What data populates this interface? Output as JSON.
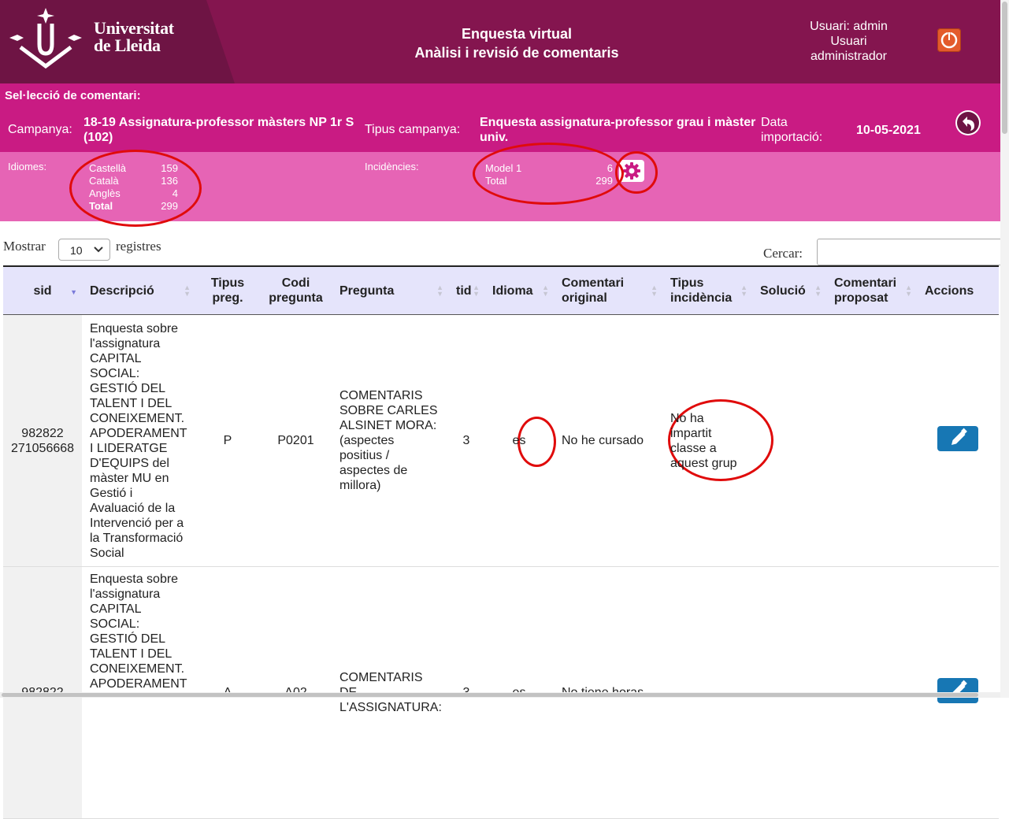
{
  "header": {
    "logo_line1": "Universitat",
    "logo_line2": "de Lleida",
    "title_line1": "Enquesta virtual",
    "title_line2": "Anàlisi i revisió de comentaris",
    "user_line1": "Usuari: admin",
    "user_line2": "Usuari",
    "user_line3": "administrador",
    "logout_icon": "power-icon"
  },
  "selection": {
    "title": "Sel·lecció de comentari:",
    "campaign_label": "Campanya:",
    "campaign_value": "18-19 Assignatura-professor màsters NP 1r S (102)",
    "type_label": "Tipus campanya:",
    "type_value": "Enquesta assignatura-professor grau i màster univ.",
    "date_label": "Data importació:",
    "date_value": "10-05-2021",
    "back_icon": "back-arrow-icon"
  },
  "stats": {
    "languages_label": "Idiomes:",
    "languages": [
      {
        "name": "Castellà",
        "count": "159"
      },
      {
        "name": "Català",
        "count": "136"
      },
      {
        "name": "Anglès",
        "count": "4"
      },
      {
        "name": "Total",
        "count": "299"
      }
    ],
    "incidents_label": "Incidències:",
    "incidents": [
      {
        "name": "Model 1",
        "count": "6"
      },
      {
        "name": "Total",
        "count": "299"
      }
    ],
    "gear_icon": "gear-icon"
  },
  "controls": {
    "show_label": "Mostrar",
    "length_value": "10",
    "records_label": "registres",
    "search_label": "Cercar:",
    "search_value": ""
  },
  "table": {
    "headers": {
      "sid": "sid",
      "descripcio": "Descripció",
      "tipus_preg": "Tipus preg.",
      "codi": "Codi pregunta",
      "pregunta": "Pregunta",
      "tid": "tid",
      "idioma": "Idioma",
      "comentari": "Comentari original",
      "tipus_inc": "Tipus incidència",
      "solucio": "Solució",
      "proposat": "Comentari proposat",
      "accions": "Accions"
    },
    "rows": [
      {
        "sid_a": "982822",
        "sid_b": "271056668",
        "descripcio": "Enquesta sobre l'assignatura CAPITAL SOCIAL: GESTIÓ DEL TALENT I DEL CONEIXEMENT. APODERAMENT I LIDERATGE D'EQUIPS del màster MU en Gestió i Avaluació de la Intervenció per a la Transformació Social",
        "tipus": "P",
        "codi": "P0201",
        "pregunta": "COMENTARIS SOBRE CARLES ALSINET MORA: (aspectes positius / aspectes de millora)",
        "tid": "3",
        "idioma": "es",
        "comentari": "No he cursado",
        "incidencia": "No ha impartit classe a aquest grup",
        "solucio": "",
        "proposat": ""
      },
      {
        "sid_a": "982822",
        "sid_b": "",
        "descripcio": "Enquesta sobre l'assignatura CAPITAL SOCIAL: GESTIÓ DEL TALENT I DEL CONEIXEMENT. APODERAMENT",
        "tipus": "A",
        "codi": "A02",
        "pregunta": "COMENTARIS DE L'ASSIGNATURA:",
        "tid": "3",
        "idioma": "es",
        "comentari": "No tiene horas",
        "incidencia": "",
        "solucio": "",
        "proposat": ""
      }
    ],
    "edit_icon": "pencil-icon"
  },
  "colors": {
    "header_bg": "#84154f",
    "selection_bg": "#c91b83",
    "stats_bg": "#e664b5",
    "table_header_bg": "#e5e4fb",
    "edit_button": "#1777b4",
    "annotation_ring": "#e00b0b"
  }
}
